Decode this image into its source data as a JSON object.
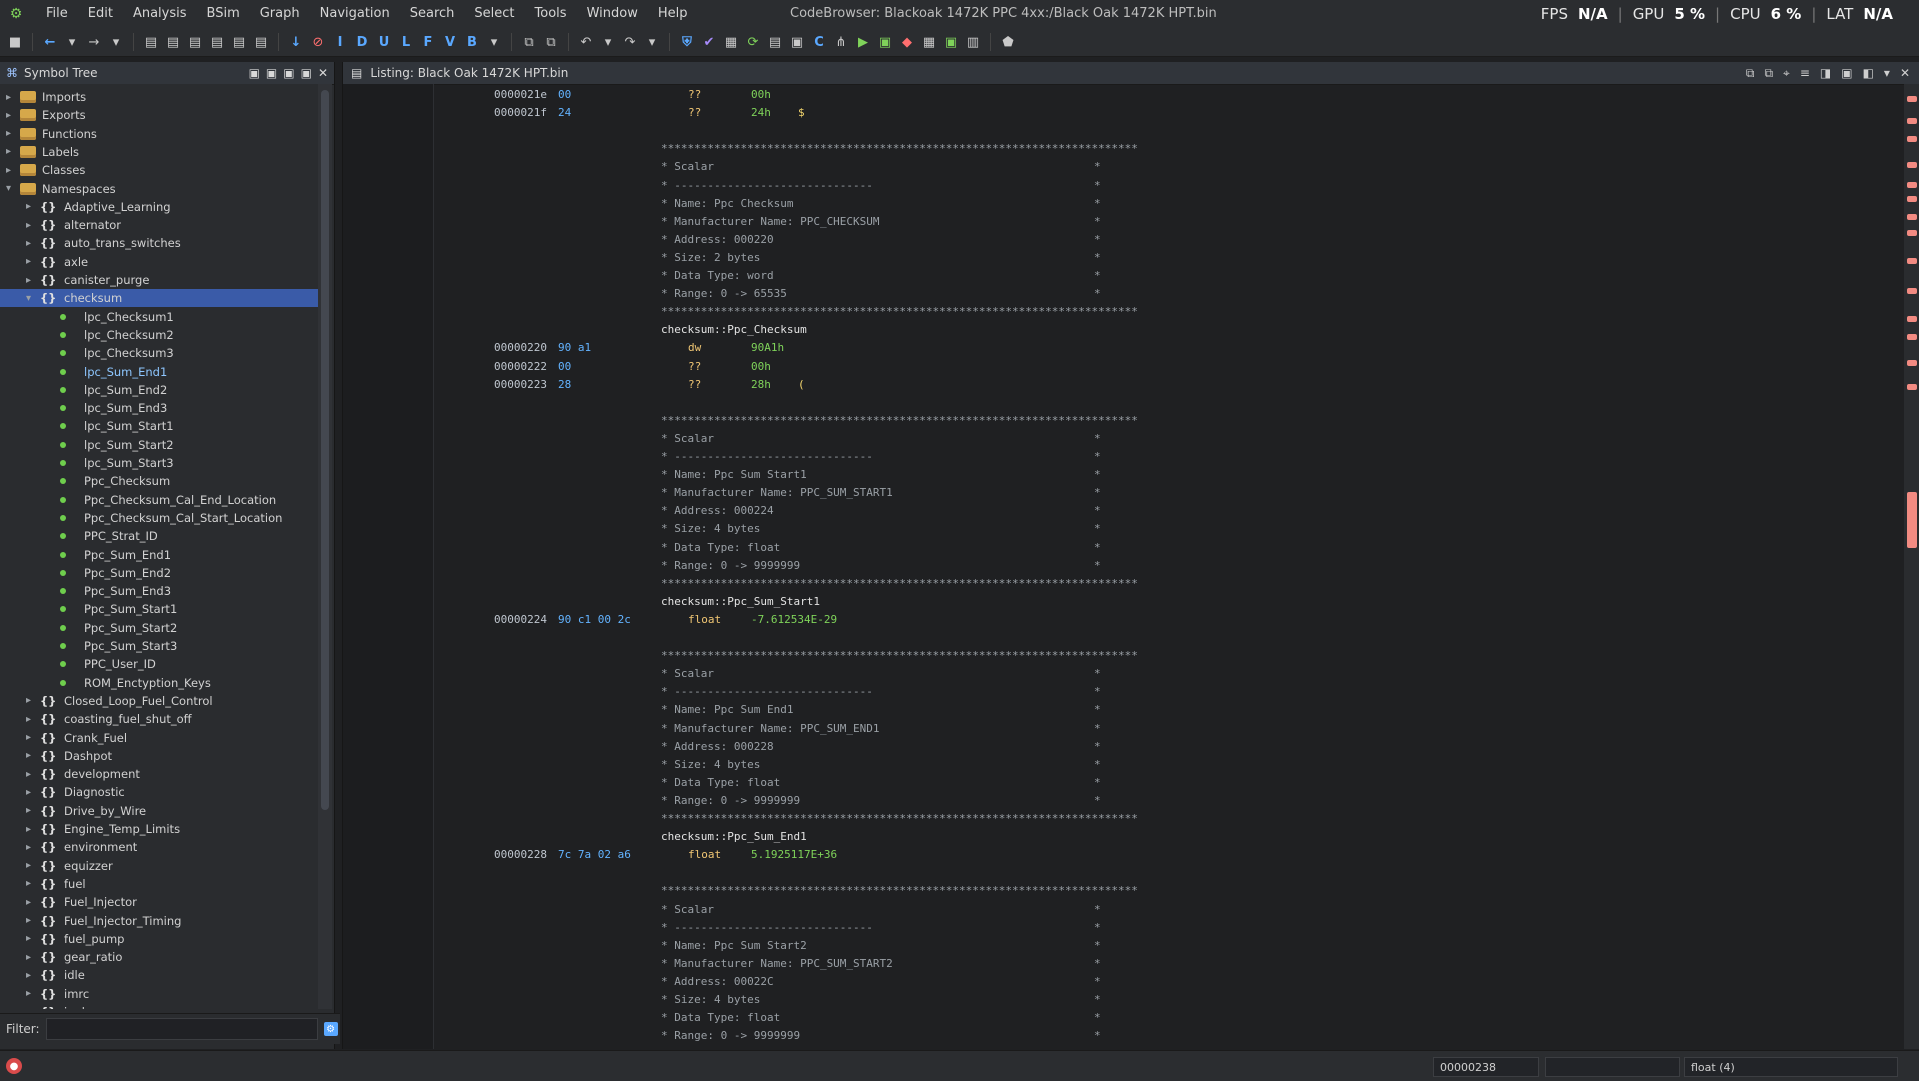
{
  "menubar": {
    "items": [
      "File",
      "Edit",
      "Analysis",
      "BSim",
      "Graph",
      "Navigation",
      "Search",
      "Select",
      "Tools",
      "Window",
      "Help"
    ],
    "window_title": "CodeBrowser: Blackoak 1472K PPC 4xx:/Black Oak 1472K HPT.bin",
    "perf": {
      "fps_label": "FPS",
      "fps_value": "N/A",
      "gpu_label": "GPU",
      "gpu_value": "5 %",
      "cpu_label": "CPU",
      "cpu_value": "6 %",
      "lat_label": "LAT",
      "lat_value": "N/A"
    }
  },
  "toolbar": {
    "letters": [
      "I",
      "D",
      "U",
      "L",
      "F",
      "V",
      "B"
    ]
  },
  "symbol_tree": {
    "title": "Symbol Tree",
    "rows": [
      {
        "label": "Imports",
        "type": "folder",
        "level": 0
      },
      {
        "label": "Exports",
        "type": "folder",
        "level": 0
      },
      {
        "label": "Functions",
        "type": "folder",
        "level": 0
      },
      {
        "label": "Labels",
        "type": "folder",
        "level": 0
      },
      {
        "label": "Classes",
        "type": "folder",
        "level": 0
      },
      {
        "label": "Namespaces",
        "type": "folder",
        "level": 0,
        "expanded": true
      },
      {
        "label": "Adaptive_Learning",
        "type": "ns",
        "level": 1
      },
      {
        "label": "alternator",
        "type": "ns",
        "level": 1
      },
      {
        "label": "auto_trans_switches",
        "type": "ns",
        "level": 1
      },
      {
        "label": "axle",
        "type": "ns",
        "level": 1
      },
      {
        "label": "canister_purge",
        "type": "ns",
        "level": 1
      },
      {
        "label": "checksum",
        "type": "ns",
        "level": 1,
        "selected": true,
        "expanded": true
      },
      {
        "label": "lpc_Checksum1",
        "type": "leaf",
        "level": 2
      },
      {
        "label": "lpc_Checksum2",
        "type": "leaf",
        "level": 2
      },
      {
        "label": "lpc_Checksum3",
        "type": "leaf",
        "level": 2
      },
      {
        "label": "lpc_Sum_End1",
        "type": "leaf",
        "level": 2,
        "highlight": true
      },
      {
        "label": "lpc_Sum_End2",
        "type": "leaf",
        "level": 2
      },
      {
        "label": "lpc_Sum_End3",
        "type": "leaf",
        "level": 2
      },
      {
        "label": "lpc_Sum_Start1",
        "type": "leaf",
        "level": 2
      },
      {
        "label": "lpc_Sum_Start2",
        "type": "leaf",
        "level": 2
      },
      {
        "label": "lpc_Sum_Start3",
        "type": "leaf",
        "level": 2
      },
      {
        "label": "Ppc_Checksum",
        "type": "leaf",
        "level": 2
      },
      {
        "label": "Ppc_Checksum_Cal_End_Location",
        "type": "leaf",
        "level": 2
      },
      {
        "label": "Ppc_Checksum_Cal_Start_Location",
        "type": "leaf",
        "level": 2
      },
      {
        "label": "PPC_Strat_ID",
        "type": "leaf",
        "level": 2
      },
      {
        "label": "Ppc_Sum_End1",
        "type": "leaf",
        "level": 2
      },
      {
        "label": "Ppc_Sum_End2",
        "type": "leaf",
        "level": 2
      },
      {
        "label": "Ppc_Sum_End3",
        "type": "leaf",
        "level": 2
      },
      {
        "label": "Ppc_Sum_Start1",
        "type": "leaf",
        "level": 2
      },
      {
        "label": "Ppc_Sum_Start2",
        "type": "leaf",
        "level": 2
      },
      {
        "label": "Ppc_Sum_Start3",
        "type": "leaf",
        "level": 2
      },
      {
        "label": "PPC_User_ID",
        "type": "leaf",
        "level": 2
      },
      {
        "label": "ROM_Enctyption_Keys",
        "type": "leaf",
        "level": 2
      },
      {
        "label": "Closed_Loop_Fuel_Control",
        "type": "ns",
        "level": 1
      },
      {
        "label": "coasting_fuel_shut_off",
        "type": "ns",
        "level": 1
      },
      {
        "label": "Crank_Fuel",
        "type": "ns",
        "level": 1
      },
      {
        "label": "Dashpot",
        "type": "ns",
        "level": 1
      },
      {
        "label": "development",
        "type": "ns",
        "level": 1
      },
      {
        "label": "Diagnostic",
        "type": "ns",
        "level": 1
      },
      {
        "label": "Drive_by_Wire",
        "type": "ns",
        "level": 1
      },
      {
        "label": "Engine_Temp_Limits",
        "type": "ns",
        "level": 1
      },
      {
        "label": "environment",
        "type": "ns",
        "level": 1
      },
      {
        "label": "equizzer",
        "type": "ns",
        "level": 1
      },
      {
        "label": "fuel",
        "type": "ns",
        "level": 1
      },
      {
        "label": "Fuel_Injector",
        "type": "ns",
        "level": 1
      },
      {
        "label": "Fuel_Injector_Timing",
        "type": "ns",
        "level": 1
      },
      {
        "label": "fuel_pump",
        "type": "ns",
        "level": 1
      },
      {
        "label": "gear_ratio",
        "type": "ns",
        "level": 1
      },
      {
        "label": "idle",
        "type": "ns",
        "level": 1
      },
      {
        "label": "imrc",
        "type": "ns",
        "level": 1
      },
      {
        "label": "junk",
        "type": "ns",
        "level": 1
      }
    ],
    "filter_label": "Filter:",
    "filter_value": ""
  },
  "listing": {
    "title": "Listing:  Black Oak 1472K HPT.bin",
    "lines": [
      {
        "kind": "data",
        "addr": "0000021e",
        "bytes": "00",
        "mnem": "??",
        "operand": "00h",
        "comment": ""
      },
      {
        "kind": "data",
        "addr": "0000021f",
        "bytes": "24",
        "mnem": "??",
        "operand": "24h",
        "comment": "$"
      },
      {
        "kind": "blank"
      },
      {
        "kind": "stars"
      },
      {
        "kind": "comment",
        "text": "* Scalar"
      },
      {
        "kind": "comment",
        "text": "* ------------------------------"
      },
      {
        "kind": "comment",
        "text": "* Name: Ppc Checksum"
      },
      {
        "kind": "comment",
        "text": "* Manufacturer Name: PPC_CHECKSUM"
      },
      {
        "kind": "comment",
        "text": "* Address: 000220"
      },
      {
        "kind": "comment",
        "text": "* Size: 2 bytes"
      },
      {
        "kind": "comment",
        "text": "* Data Type: word"
      },
      {
        "kind": "comment",
        "text": "* Range: 0 -> 65535"
      },
      {
        "kind": "stars"
      },
      {
        "kind": "label",
        "text": "checksum::Ppc_Checksum"
      },
      {
        "kind": "data",
        "addr": "00000220",
        "bytes": "90 a1",
        "mnem": "dw",
        "operand": "90A1h",
        "comment": ""
      },
      {
        "kind": "data",
        "addr": "00000222",
        "bytes": "00",
        "mnem": "??",
        "operand": "00h",
        "comment": ""
      },
      {
        "kind": "data",
        "addr": "00000223",
        "bytes": "28",
        "mnem": "??",
        "operand": "28h",
        "comment": "("
      },
      {
        "kind": "blank"
      },
      {
        "kind": "stars"
      },
      {
        "kind": "comment",
        "text": "* Scalar"
      },
      {
        "kind": "comment",
        "text": "* ------------------------------"
      },
      {
        "kind": "comment",
        "text": "* Name: Ppc Sum Start1"
      },
      {
        "kind": "comment",
        "text": "* Manufacturer Name: PPC_SUM_START1"
      },
      {
        "kind": "comment",
        "text": "* Address: 000224"
      },
      {
        "kind": "comment",
        "text": "* Size: 4 bytes"
      },
      {
        "kind": "comment",
        "text": "* Data Type: float"
      },
      {
        "kind": "comment",
        "text": "* Range: 0 -> 9999999"
      },
      {
        "kind": "stars"
      },
      {
        "kind": "label",
        "text": "checksum::Ppc_Sum_Start1"
      },
      {
        "kind": "data",
        "addr": "00000224",
        "bytes": "90 c1 00 2c",
        "mnem": "float",
        "operand": "-7.612534E-29",
        "comment": ""
      },
      {
        "kind": "blank"
      },
      {
        "kind": "stars"
      },
      {
        "kind": "comment",
        "text": "* Scalar"
      },
      {
        "kind": "comment",
        "text": "* ------------------------------"
      },
      {
        "kind": "comment",
        "text": "* Name: Ppc Sum End1"
      },
      {
        "kind": "comment",
        "text": "* Manufacturer Name: PPC_SUM_END1"
      },
      {
        "kind": "comment",
        "text": "* Address: 000228"
      },
      {
        "kind": "comment",
        "text": "* Size: 4 bytes"
      },
      {
        "kind": "comment",
        "text": "* Data Type: float"
      },
      {
        "kind": "comment",
        "text": "* Range: 0 -> 9999999"
      },
      {
        "kind": "stars"
      },
      {
        "kind": "label",
        "text": "checksum::Ppc_Sum_End1"
      },
      {
        "kind": "data",
        "addr": "00000228",
        "bytes": "7c 7a 02 a6",
        "mnem": "float",
        "operand": "5.1925117E+36",
        "comment": ""
      },
      {
        "kind": "blank"
      },
      {
        "kind": "stars"
      },
      {
        "kind": "comment",
        "text": "* Scalar"
      },
      {
        "kind": "comment",
        "text": "* ------------------------------"
      },
      {
        "kind": "comment",
        "text": "* Name: Ppc Sum Start2"
      },
      {
        "kind": "comment",
        "text": "* Manufacturer Name: PPC_SUM_START2"
      },
      {
        "kind": "comment",
        "text": "* Address: 00022C"
      },
      {
        "kind": "comment",
        "text": "* Size: 4 bytes"
      },
      {
        "kind": "comment",
        "text": "* Data Type: float"
      },
      {
        "kind": "comment",
        "text": "* Range: 0 -> 9999999"
      },
      {
        "kind": "stars"
      }
    ]
  },
  "statusbar": {
    "address": "00000238",
    "type": "float  (4)"
  },
  "colors": {
    "background": "#1f2022",
    "panel": "#2a2c2f",
    "selected": "#3a5ba8",
    "address_bytes": "#63b3ff",
    "operand": "#7fd35a",
    "mnemonic": "#f0c674"
  }
}
